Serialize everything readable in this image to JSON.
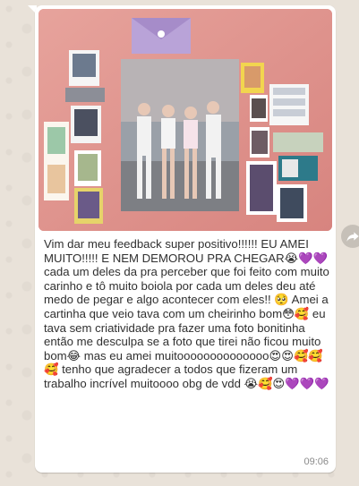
{
  "message": {
    "text": "Vim dar meu feedback super positivo!!!!!! EU AMEI MUITO!!!!! E NEM DEMOROU PRA CHEGAR😭💜💜 cada um deles da pra perceber que foi feito com muito carinho e tô muito boiola por cada um deles deu até medo de pegar e algo acontecer com eles!! 🥺 Amei a cartinha que veio tava com um cheirinho bom😳🥰 eu tava sem criatividade pra fazer uma foto bonitinha então me desculpa se a foto que tirei não ficou muito bom😂 mas eu amei muitoooooooooooooo😍😍🥰🥰🥰 tenho que agradecer a todos que fizeram um trabalho incrível muitoooo obg de vdd 😭🥰😍💜💜💜",
    "time": "09:06"
  },
  "photo": {
    "description_icon": "blackpink-merch-photo"
  },
  "colors": {
    "bubble": "#ffffff",
    "wallpaper": "#e9e2d9",
    "text": "#303030",
    "time": "#8a8a8a"
  }
}
